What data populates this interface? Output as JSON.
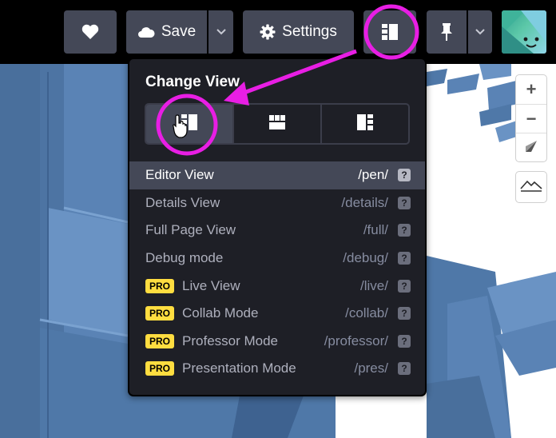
{
  "topbar": {
    "like_icon": "heart-icon",
    "save_label": "Save",
    "save_icon": "cloud-icon",
    "settings_label": "Settings",
    "settings_icon": "gear-icon",
    "layout_icon": "layout-icon",
    "pin_icon": "pin-icon",
    "avatar_icon": "smiley-avatar"
  },
  "map_controls": {
    "zoom_in": "+",
    "zoom_out": "−",
    "compass_icon": "compass-icon",
    "terrain_icon": "terrain-icon"
  },
  "change_view": {
    "title": "Change View",
    "layouts": [
      {
        "icon": "layout-left-icon",
        "active": true
      },
      {
        "icon": "layout-top-icon",
        "active": false
      },
      {
        "icon": "layout-right-icon",
        "active": false
      }
    ],
    "items": [
      {
        "label": "Editor View",
        "path": "/pen/",
        "pro": false,
        "active": true
      },
      {
        "label": "Details View",
        "path": "/details/",
        "pro": false,
        "active": false
      },
      {
        "label": "Full Page View",
        "path": "/full/",
        "pro": false,
        "active": false
      },
      {
        "label": "Debug mode",
        "path": "/debug/",
        "pro": false,
        "active": false
      },
      {
        "label": "Live View",
        "path": "/live/",
        "pro": true,
        "active": false
      },
      {
        "label": "Collab Mode",
        "path": "/collab/",
        "pro": true,
        "active": false
      },
      {
        "label": "Professor Mode",
        "path": "/professor/",
        "pro": true,
        "active": false
      },
      {
        "label": "Presentation Mode",
        "path": "/pres/",
        "pro": true,
        "active": false
      }
    ],
    "pro_badge": "PRO",
    "help_glyph": "?"
  },
  "colors": {
    "annotation": "#e81ee4",
    "scene_blue": "#4f78a8",
    "pro_badge": "#ffdd40"
  }
}
